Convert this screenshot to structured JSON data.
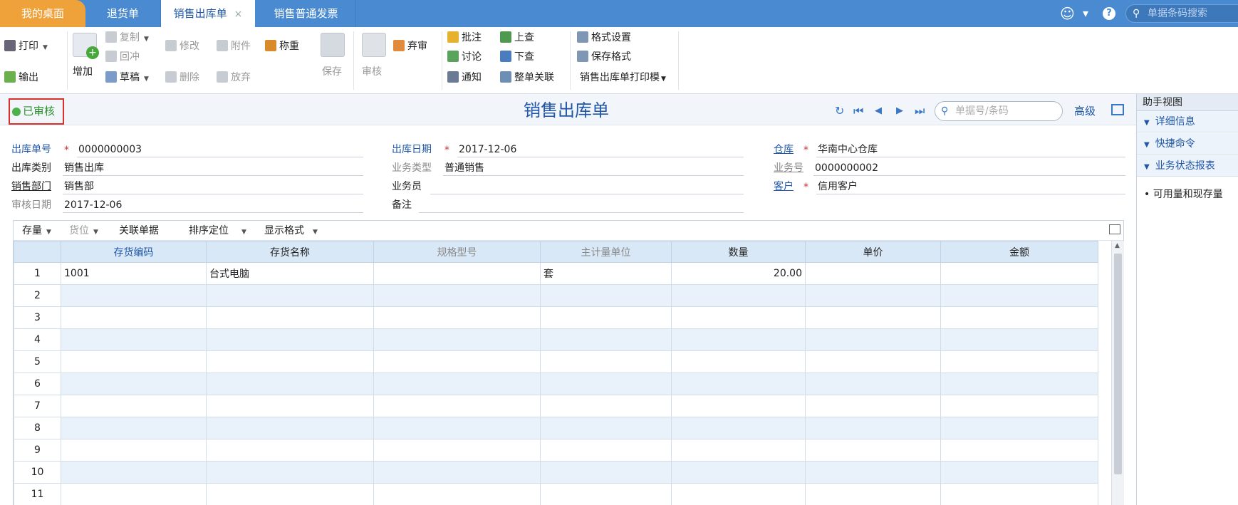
{
  "tabs": {
    "home": "我的桌面",
    "returns": "退货单",
    "active": "销售出库单",
    "active_close": "×",
    "invoice": "销售普通发票"
  },
  "top_search": {
    "placeholder": "单据条码搜索"
  },
  "top_icons": {
    "smile": "☺",
    "dropdown": "▾",
    "help": "?"
  },
  "ribbon": {
    "print": "打印",
    "export": "输出",
    "add": "增加",
    "copy": "复制",
    "reverse": "回冲",
    "draft": "草稿",
    "modify": "修改",
    "delete": "删除",
    "attachment": "附件",
    "abandon": "放弃",
    "weigh": "称重",
    "save": "保存",
    "approve": "审核",
    "unapprove": "弃审",
    "annotate": "批注",
    "discuss": "讨论",
    "notify": "通知",
    "up_lookup": "上查",
    "down_lookup": "下查",
    "whole_link": "整单关联",
    "format_settings": "格式设置",
    "save_format": "保存格式",
    "print_template": "销售出库单打印模"
  },
  "doc": {
    "status": "已审核",
    "title": "销售出库单",
    "search_placeholder": "单据号/条码",
    "advanced": "高级",
    "nav": {
      "refresh": "↻",
      "first": "⏮",
      "prev": "◀",
      "next": "▶",
      "last": "⏭"
    }
  },
  "form": {
    "out_no": {
      "label": "出库单号",
      "value": "0000000003"
    },
    "out_date": {
      "label": "出库日期",
      "value": "2017-12-06"
    },
    "warehouse": {
      "label": "仓库",
      "value": "华南中心仓库"
    },
    "out_type": {
      "label": "出库类别",
      "value": "销售出库"
    },
    "biz_type": {
      "label": "业务类型",
      "value": "普通销售"
    },
    "biz_no": {
      "label": "业务号",
      "value": "0000000002"
    },
    "sales_dept": {
      "label": "销售部门",
      "value": "销售部"
    },
    "salesperson": {
      "label": "业务员",
      "value": ""
    },
    "customer": {
      "label": "客户",
      "value": "信用客户"
    },
    "audit_date": {
      "label": "审核日期",
      "value": "2017-12-06"
    },
    "remark": {
      "label": "备注",
      "value": ""
    },
    "required_mark": "*"
  },
  "grid_toolbar": {
    "inventory": "存量",
    "location": "货位",
    "related_docs": "关联单据",
    "sort_locate": "排序定位",
    "display_format": "显示格式"
  },
  "grid": {
    "columns": [
      "存货编码",
      "存货名称",
      "规格型号",
      "主计量单位",
      "数量",
      "单价",
      "金额"
    ],
    "rows": [
      [
        "1",
        "1001",
        "台式电脑",
        "",
        "套",
        "20.00",
        "",
        ""
      ],
      [
        "2",
        "",
        "",
        "",
        "",
        "",
        "",
        ""
      ],
      [
        "3",
        "",
        "",
        "",
        "",
        "",
        "",
        ""
      ],
      [
        "4",
        "",
        "",
        "",
        "",
        "",
        "",
        ""
      ],
      [
        "5",
        "",
        "",
        "",
        "",
        "",
        "",
        ""
      ],
      [
        "6",
        "",
        "",
        "",
        "",
        "",
        "",
        ""
      ],
      [
        "7",
        "",
        "",
        "",
        "",
        "",
        "",
        ""
      ],
      [
        "8",
        "",
        "",
        "",
        "",
        "",
        "",
        ""
      ],
      [
        "9",
        "",
        "",
        "",
        "",
        "",
        "",
        ""
      ],
      [
        "10",
        "",
        "",
        "",
        "",
        "",
        "",
        ""
      ],
      [
        "11",
        "",
        "",
        "",
        "",
        "",
        "",
        ""
      ]
    ]
  },
  "right_panel": {
    "title": "助手视图",
    "items": [
      "详细信息",
      "快捷命令",
      "业务状态报表"
    ],
    "bullet": "• 可用量和现存量"
  }
}
